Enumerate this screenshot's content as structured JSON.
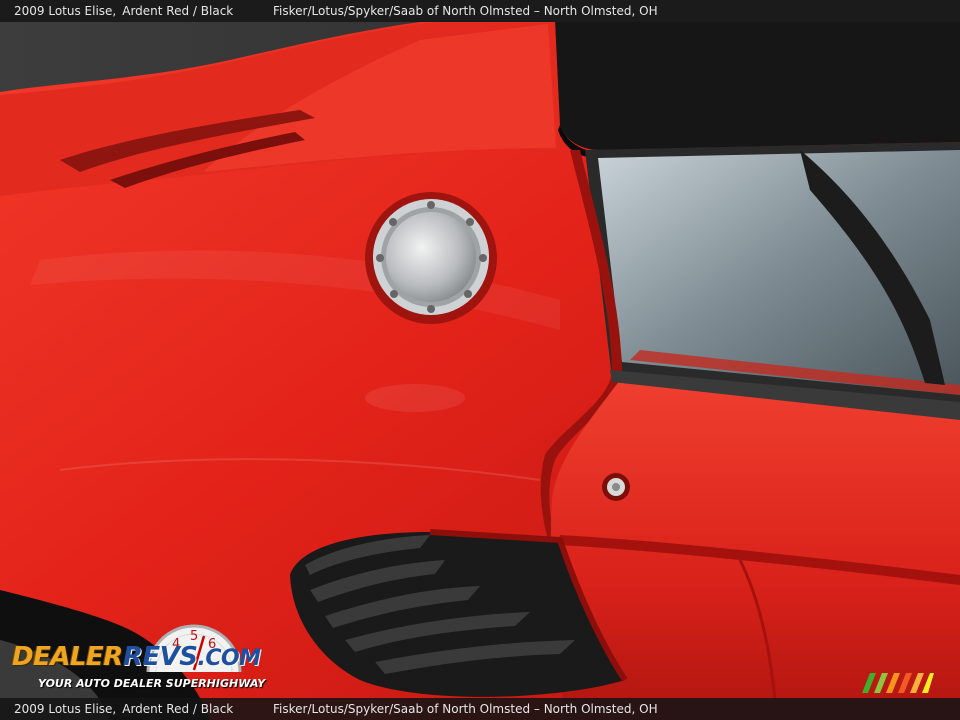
{
  "caption": {
    "vehicle": "2009 Lotus Elise,",
    "color": "Ardent Red / Black",
    "dealer": "Fisker/Lotus/Spyker/Saab of North Olmsted – North Olmsted, OH"
  },
  "watermark": {
    "brand_dealer": "DEALER",
    "brand_revs": "REVS",
    "brand_com": ".COM",
    "tagline": "YOUR AUTO DEALER SUPERHIGHWAY",
    "gauge_digits": [
      "4",
      "5",
      "6"
    ]
  },
  "colors": {
    "body_red": "#e8231a",
    "roof_black": "#141414",
    "logo_orange": "#f0a520",
    "logo_blue": "#1f4f9f"
  }
}
